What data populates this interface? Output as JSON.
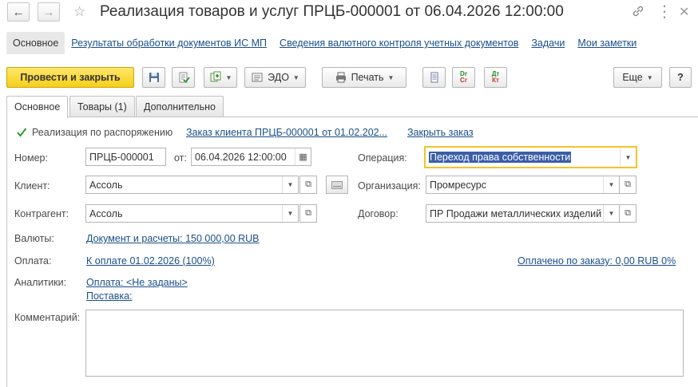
{
  "window": {
    "title": "Реализация товаров и услуг ПРЦБ-000001 от 06.04.2026 12:00:00"
  },
  "nav_links": [
    {
      "label": "Основное",
      "active": true
    },
    {
      "label": "Результаты обработки документов ИС МП",
      "active": false
    },
    {
      "label": "Сведения валютного контроля учетных документов",
      "active": false
    },
    {
      "label": "Задачи",
      "active": false
    },
    {
      "label": "Мои заметки",
      "active": false
    }
  ],
  "toolbar": {
    "post_close": "Провести и закрыть",
    "edo": "ЭДО",
    "print": "Печать",
    "more": "Еще",
    "help": "?",
    "dt_cr": {
      "top": "Dr",
      "bottom": "Cr"
    },
    "dt_kt": {
      "top": "Дт",
      "bottom": "Кт"
    }
  },
  "tabs": [
    {
      "label": "Основное",
      "active": true
    },
    {
      "label": "Товары (1)",
      "active": false
    },
    {
      "label": "Дополнительно",
      "active": false
    }
  ],
  "form": {
    "by_order_label": "Реализация по распоряжению",
    "by_order_checked": true,
    "order_link": "Заказ клиента ПРЦБ-000001 от 01.02.202...",
    "close_order": "Закрыть заказ",
    "number_label": "Номер:",
    "number_value": "ПРЦБ-000001",
    "date_label": "от:",
    "date_value": "06.04.2026 12:00:00",
    "client_label": "Клиент:",
    "client_value": "Ассоль",
    "counterparty_label": "Контрагент:",
    "counterparty_value": "Ассоль",
    "operation_label": "Операция:",
    "operation_value": "Переход права собственности",
    "organization_label": "Организация:",
    "organization_value": "Промресурс",
    "contract_label": "Договор:",
    "contract_value": "ПР Продажи металлических изделий",
    "currency_label": "Валюты:",
    "currency_link": "Документ и расчеты: 150 000,00 RUB",
    "payment_label": "Оплата:",
    "payment_link": "К оплате 01.02.2026 (100%)",
    "paid_link": "Оплачено по заказу: 0,00 RUB 0%",
    "analytics_label": "Аналитики:",
    "analytics_payment": "Оплата: <Не заданы>",
    "analytics_delivery": "Поставка:",
    "comment_label": "Комментарий:",
    "comment_value": ""
  },
  "colors": {
    "accent_link": "#1a4f8b",
    "primary_button": "#f6cf1a",
    "focus_border": "#f2c32b",
    "selection": "#3a5ea8"
  }
}
